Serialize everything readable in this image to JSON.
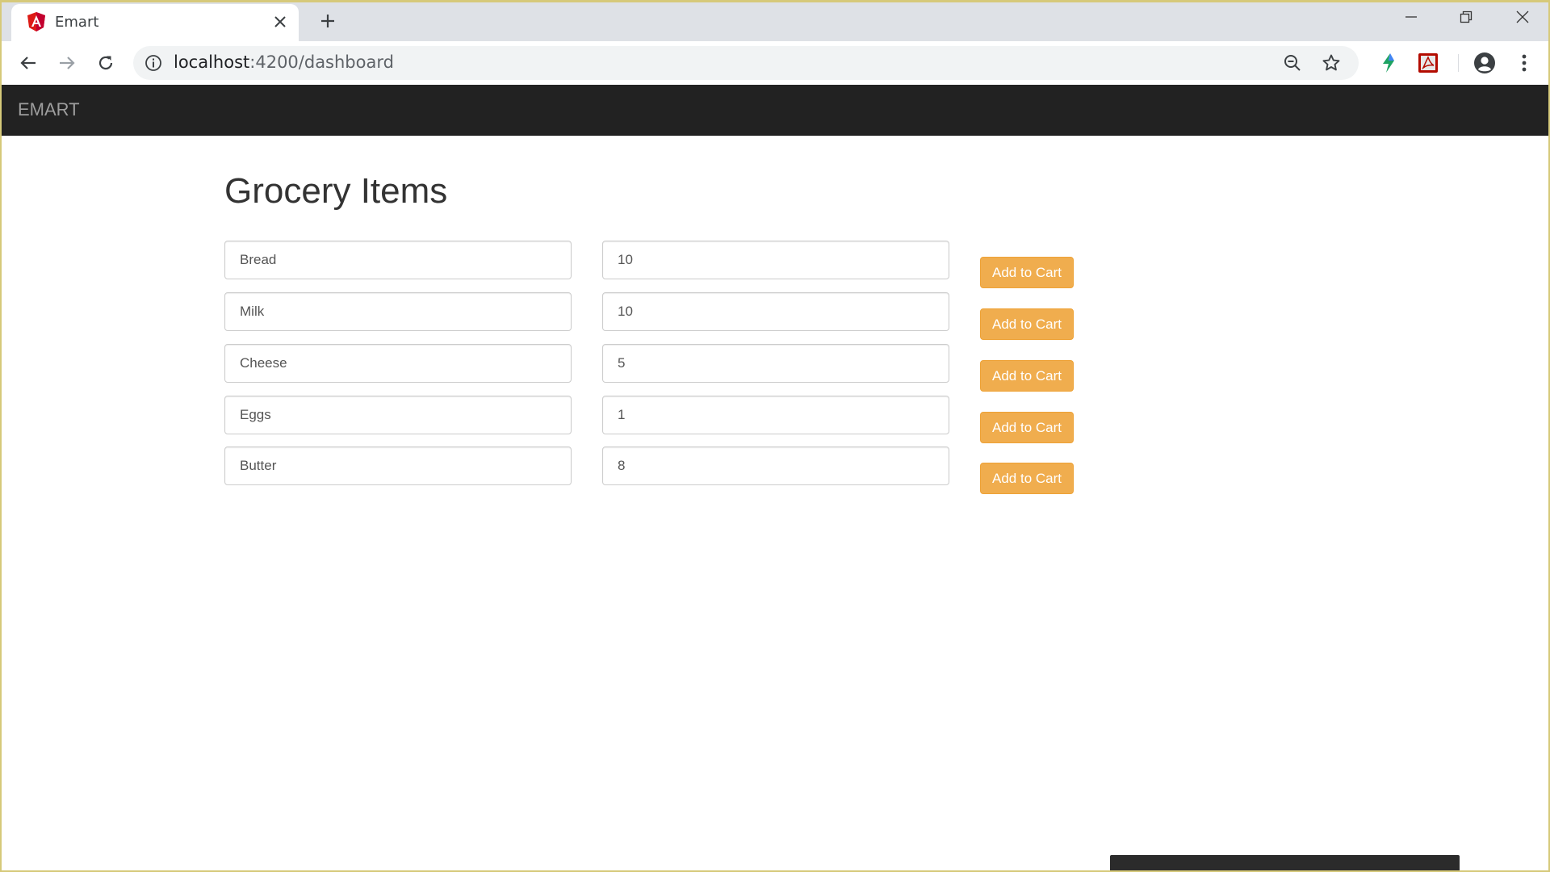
{
  "browser": {
    "tab_title": "Emart",
    "url_host": "localhost",
    "url_path": ":4200/dashboard"
  },
  "app": {
    "brand": "EMART",
    "page_title": "Grocery Items",
    "items": [
      {
        "name": "Bread",
        "quantity": "10",
        "button_label": "Add to Cart"
      },
      {
        "name": "Milk",
        "quantity": "10",
        "button_label": "Add to Cart"
      },
      {
        "name": "Cheese",
        "quantity": "5",
        "button_label": "Add to Cart"
      },
      {
        "name": "Eggs",
        "quantity": "1",
        "button_label": "Add to Cart"
      },
      {
        "name": "Butter",
        "quantity": "8",
        "button_label": "Add to Cart"
      }
    ]
  },
  "colors": {
    "navbar": "#222222",
    "warning_button": "#f0ad4e",
    "tabstrip": "#dee1e6"
  },
  "icons": [
    "angular-favicon-icon",
    "close-icon",
    "plus-icon",
    "minimize-icon",
    "restore-icon",
    "window-close-icon",
    "back-arrow-icon",
    "forward-arrow-icon",
    "reload-icon",
    "info-icon",
    "zoom-out-icon",
    "star-icon",
    "extension-icon",
    "pdf-icon",
    "profile-icon",
    "more-menu-icon"
  ]
}
